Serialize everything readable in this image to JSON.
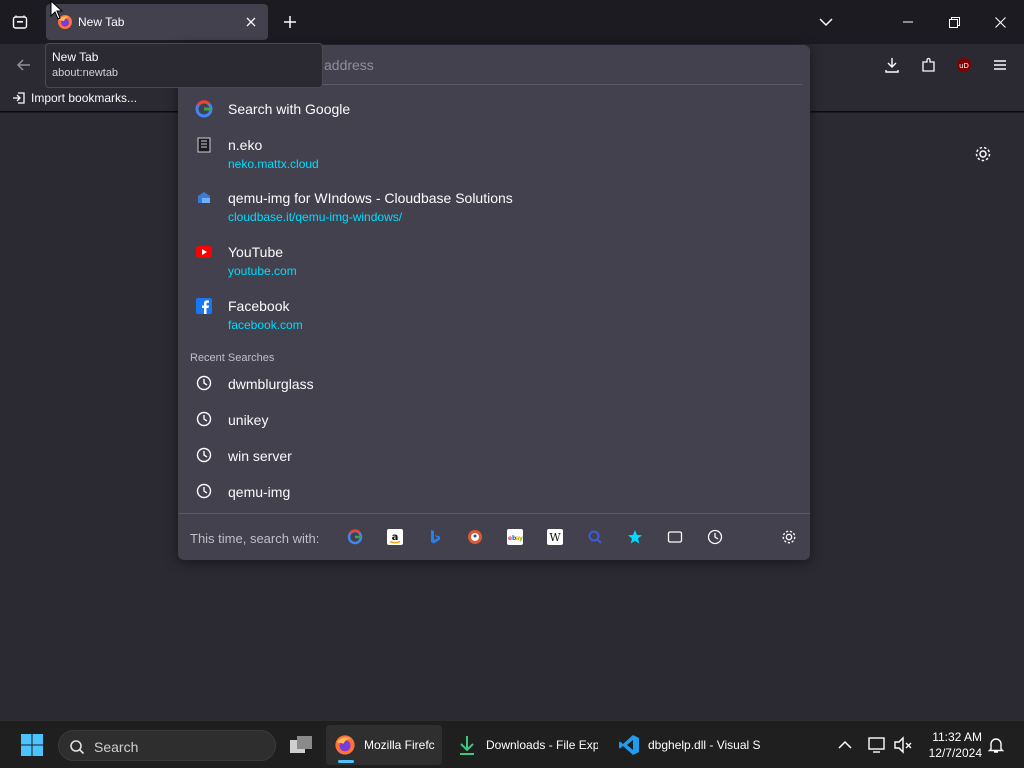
{
  "tab": {
    "title": "New Tab"
  },
  "tooltip": {
    "title": "New Tab",
    "url": "about:newtab"
  },
  "urlbar": {
    "placeholder": "address"
  },
  "bookmarks": {
    "import_label": "Import bookmarks..."
  },
  "results": [
    {
      "title": "Search with Google",
      "url": "",
      "icon": "google-icon"
    },
    {
      "title": "n.eko",
      "url": "neko.mattx.cloud",
      "icon": "neko-icon"
    },
    {
      "title": "qemu-img for WIndows - Cloudbase Solutions",
      "url": "cloudbase.it/qemu-img-windows/",
      "icon": "cloudbase-icon"
    },
    {
      "title": "YouTube",
      "url": "youtube.com",
      "icon": "youtube-icon"
    },
    {
      "title": "Facebook",
      "url": "facebook.com",
      "icon": "facebook-icon"
    }
  ],
  "recent": {
    "label": "Recent Searches",
    "items": [
      "dwmblurglass",
      "unikey",
      "win server",
      "qemu-img"
    ]
  },
  "footer": {
    "label": "This time, search with:"
  },
  "engines": [
    "google-icon",
    "amazon-icon",
    "bing-icon",
    "duckduckgo-icon",
    "ebay-icon",
    "wikipedia-icon",
    "search-icon",
    "bookmarks-star-icon",
    "tabs-icon",
    "history-icon"
  ],
  "taskbar": {
    "search_label": "Search",
    "apps": [
      "Mozilla Firefc",
      "Downloads - File Exp",
      "dbghelp.dll - Visual S"
    ],
    "time": "11:32 AM",
    "date": "12/7/2024"
  },
  "colors": {
    "accent": "#00ddff",
    "panel": "#42414d",
    "toolbar": "#2b2a33"
  }
}
